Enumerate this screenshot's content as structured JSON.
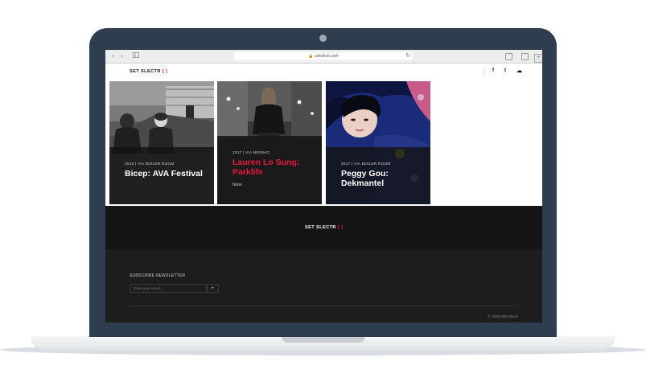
{
  "browser": {
    "url": "setslectr.com",
    "back_icon": "chevron-left-icon",
    "forward_icon": "chevron-right-icon",
    "sidebar_icon": "sidebar-icon",
    "reload_icon": "reload-icon",
    "share_icon": "share-icon",
    "tabs_icon": "tabs-icon",
    "new_tab_icon": "plus-icon"
  },
  "site": {
    "logo": "SET SLECTR",
    "logo_bracket": "[ ]",
    "accent_color": "#e8173f"
  },
  "social": [
    {
      "icon": "facebook-icon",
      "glyph": "f"
    },
    {
      "icon": "twitter-icon",
      "glyph": "t"
    },
    {
      "icon": "soundcloud-icon",
      "glyph": "☁"
    }
  ],
  "cards": [
    {
      "meta": "2015 | VIA BOILER ROOM",
      "title": "Bicep: AVA Festival",
      "desc": ""
    },
    {
      "meta": "2017 | VIA MIXMAG",
      "title": "Lauren Lo Sung: Parklife",
      "desc": "None"
    },
    {
      "meta": "2017 | VIA BOILER ROOM",
      "title": "Peggy Gou: Dekmantel",
      "desc": ""
    }
  ],
  "footer": {
    "logo": "SET SLECTR",
    "logo_bracket": "[ ]",
    "newsletter_heading": "SUBSCRIBE NEWSLETTER",
    "email_placeholder": "Enter your email...",
    "submit_glyph": "▸",
    "copyright": "© 2018 Set Slectr"
  }
}
